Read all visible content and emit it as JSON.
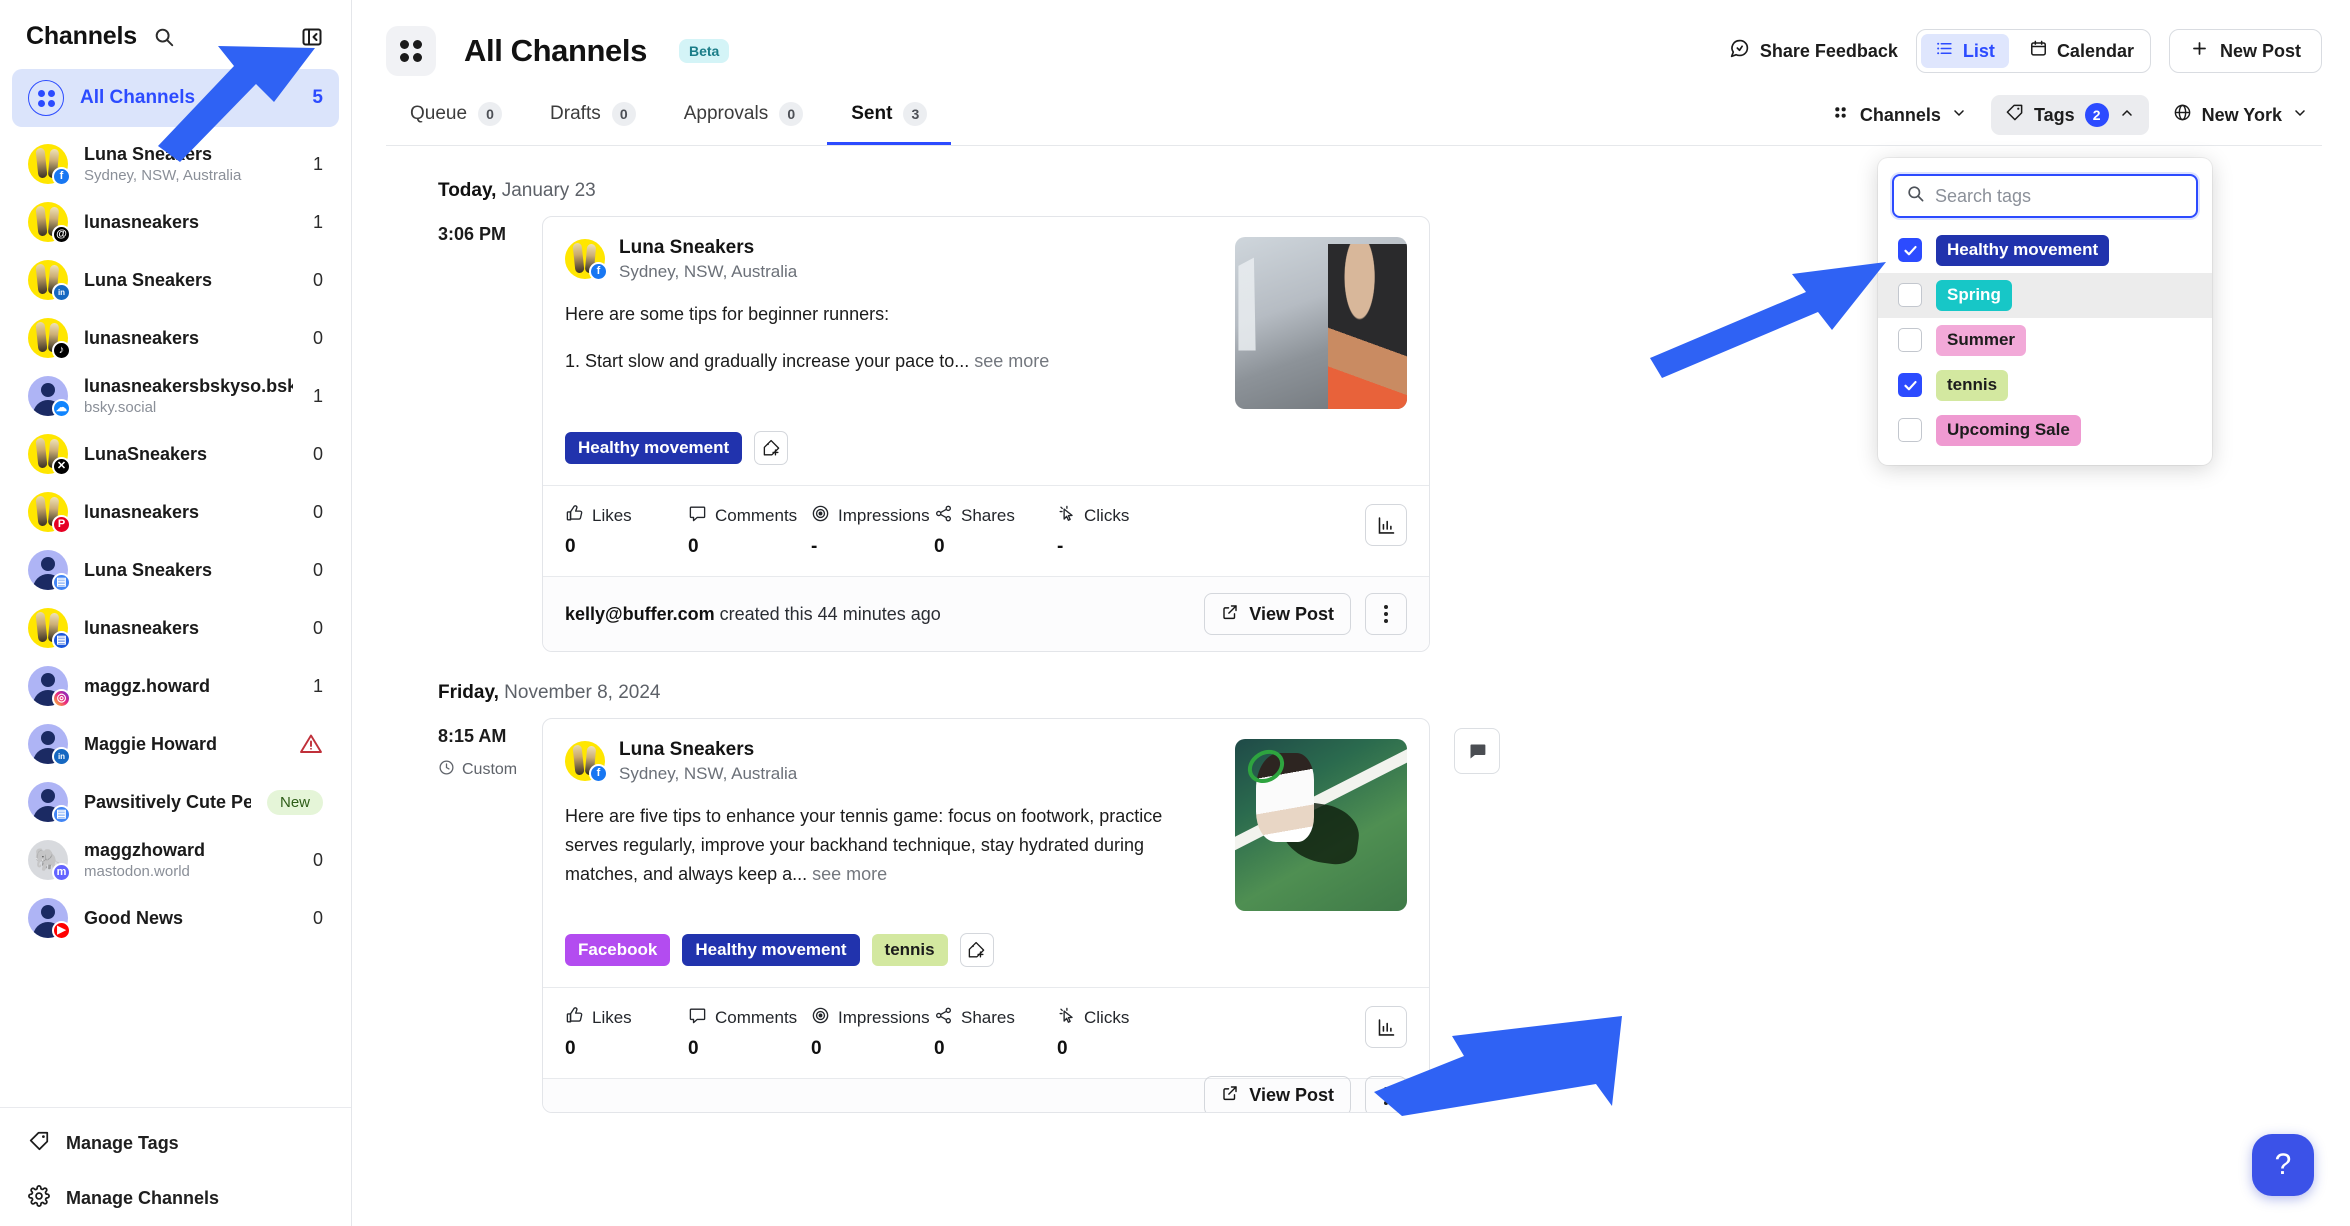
{
  "sidebar": {
    "title": "Channels",
    "search_icon": "search-icon",
    "collapse_icon": "collapse-sidebar-icon",
    "all_channels": {
      "label": "All Channels",
      "count": "5",
      "icon": "all-channels-icon"
    },
    "items": [
      {
        "label": "Luna Sneakers",
        "sub": "Sydney, NSW, Australia",
        "count": "1",
        "network": "facebook",
        "avatar": "sneaker"
      },
      {
        "label": "lunasneakers",
        "sub": "",
        "count": "1",
        "network": "threads",
        "avatar": "sneaker"
      },
      {
        "label": "Luna Sneakers",
        "sub": "",
        "count": "0",
        "network": "linkedin",
        "avatar": "sneaker"
      },
      {
        "label": "lunasneakers",
        "sub": "",
        "count": "0",
        "network": "tiktok",
        "avatar": "sneaker"
      },
      {
        "label": "lunasneakersbskyso.bsky.s",
        "sub": "bsky.social",
        "count": "1",
        "network": "bluesky",
        "avatar": "person"
      },
      {
        "label": "LunaSneakers",
        "sub": "",
        "count": "0",
        "network": "x",
        "avatar": "sneaker"
      },
      {
        "label": "lunasneakers",
        "sub": "",
        "count": "0",
        "network": "pinterest",
        "avatar": "sneaker"
      },
      {
        "label": "Luna Sneakers",
        "sub": "",
        "count": "0",
        "network": "google-business",
        "avatar": "person"
      },
      {
        "label": "lunasneakers",
        "sub": "",
        "count": "0",
        "network": "google-business-profile",
        "avatar": "sneaker"
      },
      {
        "label": "maggz.howard",
        "sub": "",
        "count": "1",
        "network": "instagram",
        "avatar": "person"
      },
      {
        "label": "Maggie Howard",
        "sub": "",
        "count": "",
        "badge": "warning",
        "network": "linkedin",
        "avatar": "person"
      },
      {
        "label": "Pawsitively Cute Pets",
        "sub": "",
        "count": "",
        "badge": "New",
        "network": "google-business",
        "avatar": "person"
      },
      {
        "label": "maggzhoward",
        "sub": "mastodon.world",
        "count": "0",
        "network": "mastodon",
        "avatar": "mastodon"
      },
      {
        "label": "Good News",
        "sub": "",
        "count": "0",
        "network": "youtube",
        "avatar": "person"
      }
    ],
    "footer": [
      {
        "label": "Manage Tags",
        "icon": "tag-icon"
      },
      {
        "label": "Manage Channels",
        "icon": "gear-icon"
      }
    ]
  },
  "header": {
    "title": "All Channels",
    "beta_badge": "Beta",
    "page_icon": "all-channels-icon",
    "share_feedback": "Share Feedback",
    "share_feedback_icon": "feedback-icon",
    "view_list": "List",
    "view_list_icon": "list-icon",
    "view_calendar": "Calendar",
    "view_calendar_icon": "calendar-icon",
    "new_post": "New Post",
    "new_post_icon": "plus-icon"
  },
  "tabs": [
    {
      "label": "Queue",
      "count": "0",
      "active": false
    },
    {
      "label": "Drafts",
      "count": "0",
      "active": false
    },
    {
      "label": "Approvals",
      "count": "0",
      "active": false
    },
    {
      "label": "Sent",
      "count": "3",
      "active": true
    }
  ],
  "filters": {
    "channels_label": "Channels",
    "channels_icon": "channels-icon",
    "tags_label": "Tags",
    "tags_icon": "tag-icon",
    "tags_count": "2",
    "timezone_label": "New York",
    "timezone_icon": "globe-icon"
  },
  "tag_menu": {
    "search_placeholder": "Search tags",
    "search_value": "",
    "search_icon": "search-icon",
    "options": [
      {
        "label": "Healthy movement",
        "checked": true,
        "bg": "#2133ad",
        "fg": "#ffffff",
        "hover": false
      },
      {
        "label": "Spring",
        "checked": false,
        "bg": "#17c7c7",
        "fg": "#ffffff",
        "hover": true
      },
      {
        "label": "Summer",
        "checked": false,
        "bg": "#f2a9d8",
        "fg": "#1c1c1c",
        "hover": false
      },
      {
        "label": "tennis",
        "checked": true,
        "bg": "#d3e8a0",
        "fg": "#1c1c1c",
        "hover": false
      },
      {
        "label": "Upcoming Sale",
        "checked": false,
        "bg": "#ef9ad1",
        "fg": "#1c1c1c",
        "hover": false
      }
    ]
  },
  "feed": {
    "groups": [
      {
        "day_prefix": "Today,",
        "day_date": "January 23",
        "posts": [
          {
            "time": "3:06 PM",
            "custom_label": "",
            "author": "Luna Sneakers",
            "location": "Sydney, NSW, Australia",
            "network": "facebook",
            "text_lines": [
              "Here are some tips for beginner runners:",
              "1. Start slow and gradually increase your pace to..."
            ],
            "see_more": "see more",
            "thumb": "runner",
            "tags": [
              {
                "label": "Healthy movement",
                "bg": "#2133ad",
                "fg": "#ffffff"
              }
            ],
            "add_tag_icon": "add-tag-icon",
            "stats": [
              {
                "label": "Likes",
                "value": "0",
                "icon": "thumbs-up-icon"
              },
              {
                "label": "Comments",
                "value": "0",
                "icon": "comment-icon"
              },
              {
                "label": "Impressions",
                "value": "-",
                "icon": "impressions-icon"
              },
              {
                "label": "Shares",
                "value": "0",
                "icon": "share-icon"
              },
              {
                "label": "Clicks",
                "value": "-",
                "icon": "click-icon"
              }
            ],
            "analytics_icon": "bar-chart-icon",
            "footer_author": "kelly@buffer.com",
            "footer_text": "created this 44 minutes ago",
            "view_post": "View Post",
            "view_post_icon": "external-link-icon",
            "kebab_icon": "more-options-icon",
            "side_comment_icon": "comment-bubble-icon",
            "has_side_comment": false
          }
        ]
      },
      {
        "day_prefix": "Friday,",
        "day_date": "November 8, 2024",
        "posts": [
          {
            "time": "8:15 AM",
            "custom_label": "Custom",
            "custom_icon": "clock-icon",
            "author": "Luna Sneakers",
            "location": "Sydney, NSW, Australia",
            "network": "facebook",
            "text_lines": [
              "Here are five tips to enhance your tennis game: focus on footwork, practice serves regularly, improve your backhand technique, stay hydrated during matches, and always keep a..."
            ],
            "see_more": "see more",
            "thumb": "tennis",
            "tags": [
              {
                "label": "Facebook",
                "bg": "#b34cf0",
                "fg": "#ffffff"
              },
              {
                "label": "Healthy movement",
                "bg": "#2133ad",
                "fg": "#ffffff"
              },
              {
                "label": "tennis",
                "bg": "#d3e8a0",
                "fg": "#1c1c1c"
              }
            ],
            "add_tag_icon": "add-tag-icon",
            "stats": [
              {
                "label": "Likes",
                "value": "0",
                "icon": "thumbs-up-icon"
              },
              {
                "label": "Comments",
                "value": "0",
                "icon": "comment-icon"
              },
              {
                "label": "Impressions",
                "value": "0",
                "icon": "impressions-icon"
              },
              {
                "label": "Shares",
                "value": "0",
                "icon": "share-icon"
              },
              {
                "label": "Clicks",
                "value": "0",
                "icon": "click-icon"
              }
            ],
            "analytics_icon": "bar-chart-icon",
            "footer_author": "",
            "footer_text": "",
            "view_post": "View Post",
            "view_post_icon": "external-link-icon",
            "kebab_icon": "more-options-icon",
            "side_comment_icon": "comment-bubble-icon",
            "has_side_comment": true
          }
        ]
      }
    ]
  },
  "help_button": {
    "label": "?",
    "icon": "help-icon"
  },
  "colors": {
    "accent": "#2c4bff",
    "arrow": "#2f62f4"
  }
}
